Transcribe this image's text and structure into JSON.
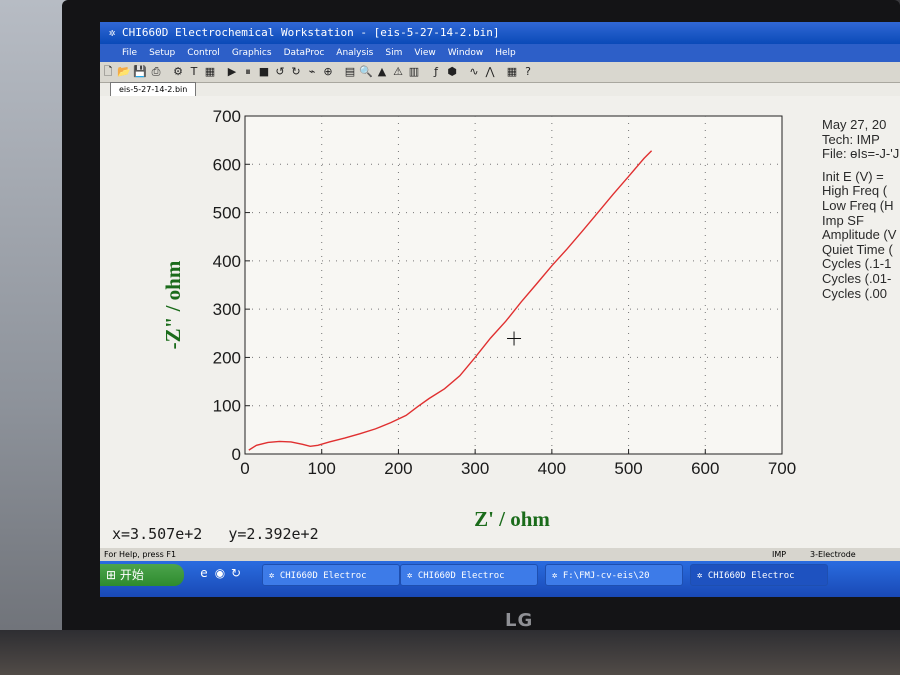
{
  "window": {
    "title": "CHI660D Electrochemical Workstation - [eis-5-27-14-2.bin]",
    "icon": "electrode-icon"
  },
  "menu": [
    "File",
    "Setup",
    "Control",
    "Graphics",
    "DataProc",
    "Analysis",
    "Sim",
    "View",
    "Window",
    "Help"
  ],
  "toolbar_icons": [
    "new-icon",
    "open-icon",
    "save-icon",
    "print-icon",
    "sep",
    "settings-icon",
    "text-icon",
    "overlay-icon",
    "sep",
    "run-icon",
    "pause-icon",
    "stop-icon",
    "reverse-icon",
    "repeat-icon",
    "filter-icon",
    "zoom-icon",
    "sep",
    "graph-icon",
    "magnify-icon",
    "peak-icon",
    "warning-icon",
    "palette-icon",
    "sep",
    "fft-icon",
    "sim-icon",
    "sep",
    "wave-icon",
    "wave2-icon",
    "sep",
    "grid-icon",
    "help-icon"
  ],
  "document_tab": "eis-5-27-14-2.bin",
  "info_panel": {
    "lines": [
      "May 27, 20",
      "Tech: IMP",
      "File: ɵIs=-J-'J",
      "",
      "Init E (V) =",
      "High Freq (",
      "Low Freq (H",
      "Imp SF",
      "Amplitude (V",
      "Quiet Time (",
      "Cycles (.1-1",
      "Cycles (.01-",
      "Cycles (.00"
    ]
  },
  "cursor_readout": {
    "x": "x=3.507e+2",
    "y": "y=2.392e+2"
  },
  "status": {
    "help": "For Help, press F1",
    "mode": "IMP",
    "electrode": "3-Electrode"
  },
  "taskbar": {
    "start_label": "开始",
    "quick_icons": [
      "ie-icon",
      "media-icon",
      "refresh-icon"
    ],
    "tasks": [
      {
        "label": "CHI660D Electroc",
        "active": false
      },
      {
        "label": "CHI660D Electroc",
        "active": false
      },
      {
        "label": "F:\\FMJ-cv-eis\\20",
        "active": false
      },
      {
        "label": "CHI660D Electroc",
        "active": true
      }
    ]
  },
  "chart_data": {
    "type": "line",
    "xlabel": "Z' / ohm",
    "ylabel": "-Z\" / ohm",
    "xlim": [
      0,
      700
    ],
    "ylim": [
      0,
      700
    ],
    "x_ticks": [
      0,
      100,
      200,
      300,
      400,
      500,
      600,
      700
    ],
    "y_ticks": [
      0,
      100,
      200,
      300,
      400,
      500,
      600,
      700
    ],
    "grid": true,
    "series": [
      {
        "color": "#e03030",
        "x": [
          5,
          15,
          30,
          45,
          60,
          75,
          85,
          95,
          110,
          130,
          150,
          170,
          190,
          210,
          225,
          240,
          260,
          280,
          300,
          320,
          340,
          360,
          380,
          400,
          420,
          440,
          460,
          480,
          500,
          520,
          530
        ],
        "y": [
          8,
          18,
          24,
          26,
          25,
          20,
          16,
          18,
          25,
          33,
          42,
          52,
          65,
          80,
          98,
          115,
          135,
          162,
          200,
          240,
          275,
          315,
          352,
          390,
          425,
          462,
          500,
          538,
          575,
          612,
          628
        ]
      }
    ],
    "crosshair": {
      "x": 350.7,
      "y": 239.2
    }
  },
  "colors": {
    "axis_label": "#1a6b1a",
    "curve": "#e03030",
    "titlebar": "#0a4ab8"
  }
}
